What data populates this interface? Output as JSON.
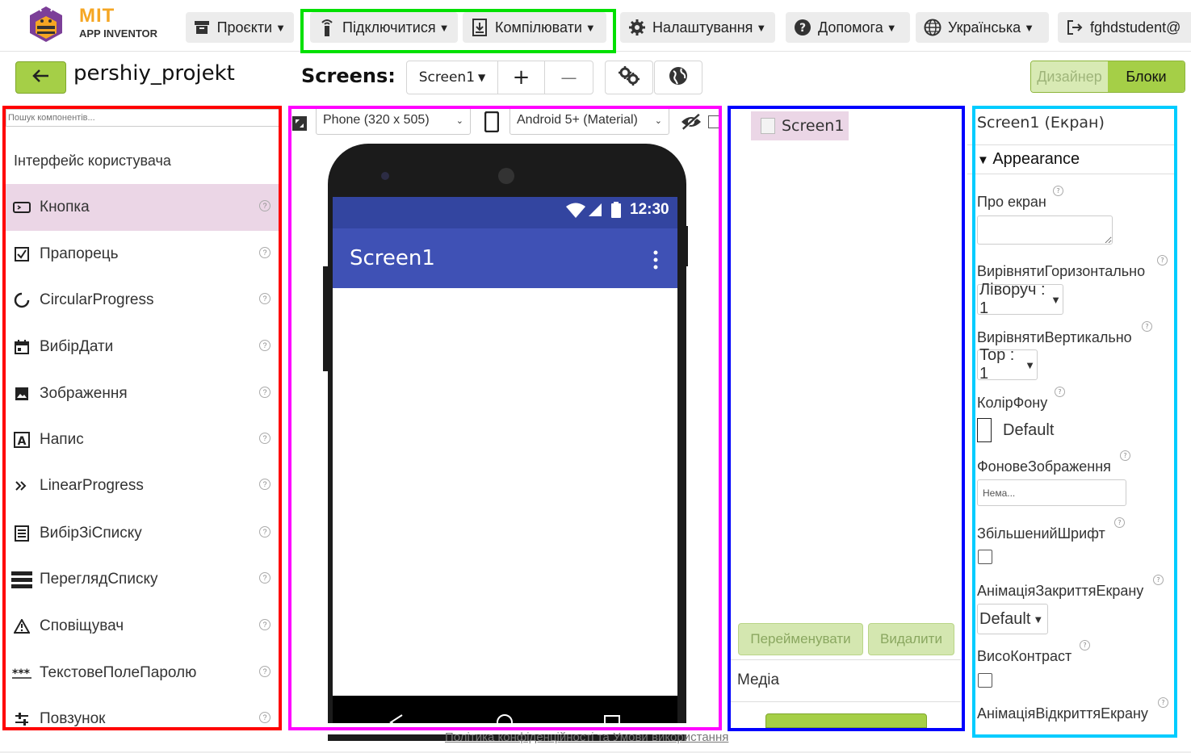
{
  "logo": {
    "title": "MIT",
    "subtitle": "APP INVENTOR"
  },
  "topnav": {
    "projects": "Проєкти",
    "connect": "Підключитися",
    "build": "Компілювати",
    "settings": "Налаштування",
    "help": "Допомога",
    "language": "Українська",
    "user": "fghdstudent@"
  },
  "toolbar": {
    "project_name": "pershiy_projekt",
    "screens_label": "Screens:",
    "screen_selected": "Screen1",
    "add_screen": "+",
    "remove_screen": "—",
    "designer": "Дизайнер",
    "blocks": "Блоки"
  },
  "palette": {
    "search_placeholder": "Пошук компонентів...",
    "category": "Інтерфейс користувача",
    "items": [
      {
        "label": "Кнопка",
        "icon": "button-icon"
      },
      {
        "label": "Прапорець",
        "icon": "checkbox-icon"
      },
      {
        "label": "CircularProgress",
        "icon": "circular-progress-icon"
      },
      {
        "label": "ВибірДати",
        "icon": "calendar-icon"
      },
      {
        "label": "Зображення",
        "icon": "image-icon"
      },
      {
        "label": "Напис",
        "icon": "label-icon"
      },
      {
        "label": "LinearProgress",
        "icon": "linear-progress-icon"
      },
      {
        "label": "ВибірЗіСписку",
        "icon": "listpicker-icon"
      },
      {
        "label": "ПереглядСписку",
        "icon": "listview-icon"
      },
      {
        "label": "Сповіщувач",
        "icon": "notifier-icon"
      },
      {
        "label": "ТекстовеПолеПаролю",
        "icon": "password-icon"
      },
      {
        "label": "Повзунок",
        "icon": "slider-icon"
      }
    ]
  },
  "viewer": {
    "device": "Phone (320 x 505)",
    "theme": "Android 5+ (Material)",
    "status_time": "12:30",
    "app_title": "Screen1"
  },
  "tree": {
    "root": "Screen1",
    "rename": "Перейменувати",
    "delete": "Видалити",
    "media": "Медіа"
  },
  "properties": {
    "title": "Screen1 (Екран)",
    "group": "Appearance",
    "about_label": "Про екран",
    "align_h_label": "ВирівнятиГоризонтально",
    "align_h_value": "Ліворуч : 1",
    "align_v_label": "ВирівнятиВертикально",
    "align_v_value": "Top : 1",
    "bgcolor_label": "КолірФону",
    "bgcolor_value": "Default",
    "bgimage_label": "ФоновеЗображення",
    "bgimage_value": "Нема...",
    "bigfont_label": "ЗбільшенийШрифт",
    "close_anim_label": "АнімаціяЗакриттяЕкрану",
    "close_anim_value": "Default",
    "contrast_label": "ВисоКонтраст",
    "open_anim_label": "АнімаціяВідкриттяЕкрану"
  },
  "footer": {
    "policy": "Політика конфіденційності та Умови використання"
  },
  "colors": {
    "red_frame": "#ff0000",
    "green_frame": "#00e000",
    "magenta_frame": "#ff00ff",
    "blue_frame": "#0000ff",
    "cyan_frame": "#00ccff",
    "accent_green": "#a5cf47",
    "material_indigo": "#3f51b5",
    "selection_pink": "#ebd6e6"
  }
}
